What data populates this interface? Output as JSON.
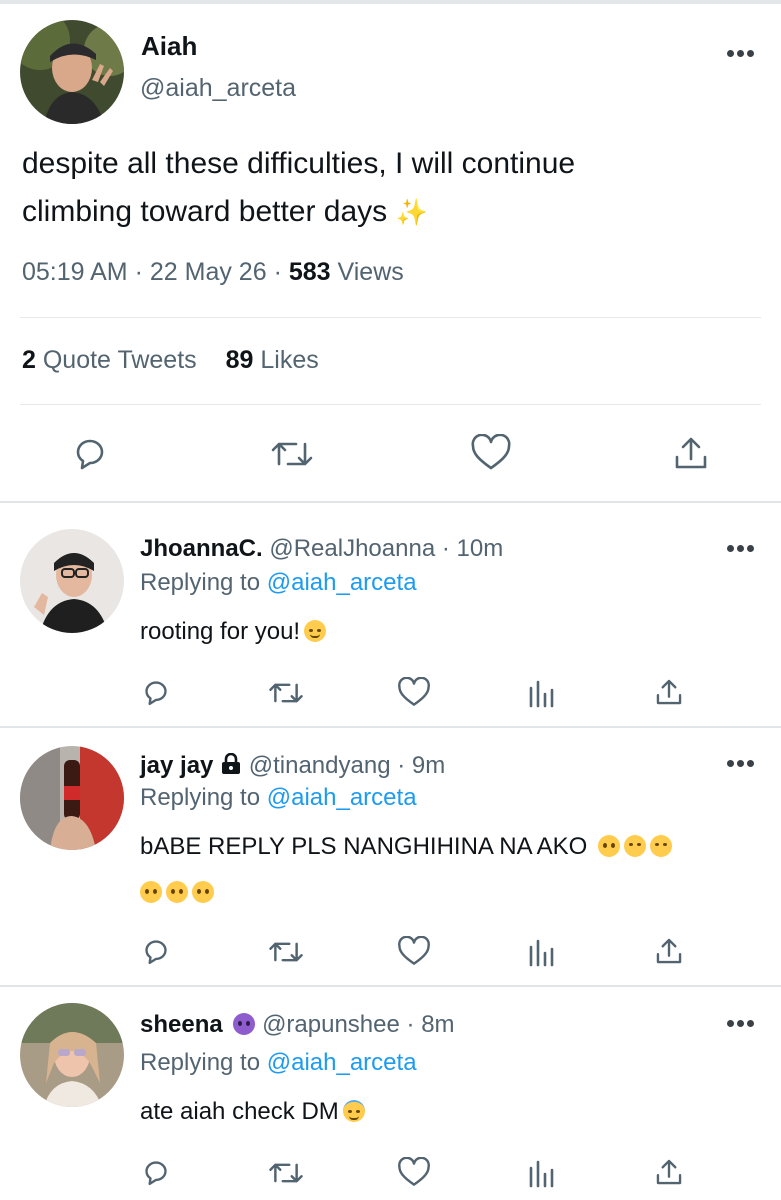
{
  "main_tweet": {
    "author_name": "Aiah",
    "author_handle": "@aiah_arceta",
    "text_line1": "despite all these difficulties, I will continue",
    "text_line2": "climbing toward better days",
    "sparkle_emoji": "✨",
    "time": "05:19 AM",
    "date": "22 May 26",
    "views_count": "583",
    "views_label": "Views",
    "quote_count": "2",
    "quote_label": "Quote Tweets",
    "likes_count": "89",
    "likes_label": "Likes",
    "separator": "·"
  },
  "replies": [
    {
      "name": "JhoannaC.",
      "handle": "@RealJhoanna",
      "time": "10m",
      "replying_prefix": "Replying to",
      "replying_handle": "@aiah_arceta",
      "text": "rooting for you!"
    },
    {
      "name": "jay jay",
      "handle": "@tinandyang",
      "time": "9m",
      "replying_prefix": "Replying to",
      "replying_handle": "@aiah_arceta",
      "text": "bABE REPLY PLS NANGHIHINA NA AKO"
    },
    {
      "name": "sheena",
      "handle": "@rapunshee",
      "time": "8m",
      "replying_prefix": "Replying to",
      "replying_handle": "@aiah_arceta",
      "text": "ate aiah check DM"
    }
  ],
  "colors": {
    "text": "#0f1419",
    "secondary": "#536471",
    "link": "#1d9bf0",
    "divider": "#e6e9ec"
  }
}
